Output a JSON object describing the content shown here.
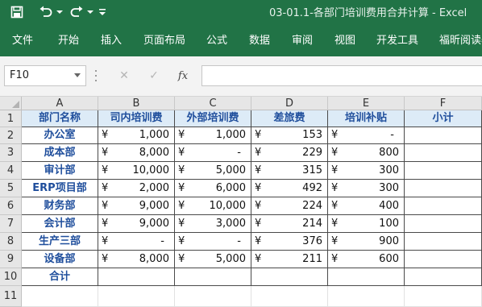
{
  "window": {
    "title": "03-01.1-各部门培训费用合并计算  -  Excel",
    "quick_access": [
      "save-icon",
      "undo-icon",
      "redo-icon",
      "customize-qat-icon"
    ]
  },
  "ribbon": {
    "tabs": [
      "文件",
      "开始",
      "插入",
      "页面布局",
      "公式",
      "数据",
      "审阅",
      "视图",
      "开发工具",
      "福昕阅读器"
    ]
  },
  "formula_bar": {
    "name_box": "F10",
    "cancel_icon": "✕",
    "enter_icon": "✓",
    "fx_label": "fx",
    "formula": ""
  },
  "sheet": {
    "column_headers": [
      "A",
      "B",
      "C",
      "D",
      "E",
      "F"
    ],
    "row_headers": [
      "1",
      "2",
      "3",
      "4",
      "5",
      "6",
      "7",
      "8",
      "9",
      "10",
      "11"
    ],
    "currency_symbol": "¥",
    "table_header": [
      "部门名称",
      "司内培训费",
      "外部培训费",
      "差旅费",
      "培训补贴",
      "小计"
    ],
    "rows": [
      {
        "dept": "办公室",
        "internal": "1,000",
        "external": "1,000",
        "travel": "153",
        "subsidy": "-"
      },
      {
        "dept": "成本部",
        "internal": "8,000",
        "external": "-",
        "travel": "229",
        "subsidy": "800"
      },
      {
        "dept": "审计部",
        "internal": "10,000",
        "external": "5,000",
        "travel": "315",
        "subsidy": "300"
      },
      {
        "dept": "ERP项目部",
        "internal": "2,000",
        "external": "6,000",
        "travel": "492",
        "subsidy": "300"
      },
      {
        "dept": "财务部",
        "internal": "9,000",
        "external": "10,000",
        "travel": "224",
        "subsidy": "400"
      },
      {
        "dept": "会计部",
        "internal": "9,000",
        "external": "3,000",
        "travel": "214",
        "subsidy": "100"
      },
      {
        "dept": "生产三部",
        "internal": "-",
        "external": "-",
        "travel": "376",
        "subsidy": "900"
      },
      {
        "dept": "设备部",
        "internal": "8,000",
        "external": "5,000",
        "travel": "211",
        "subsidy": "600"
      }
    ],
    "total_label": "合计"
  },
  "colors": {
    "excel_green": "#217346",
    "header_fill": "#ddebf7",
    "header_text": "#1f4e9c"
  }
}
